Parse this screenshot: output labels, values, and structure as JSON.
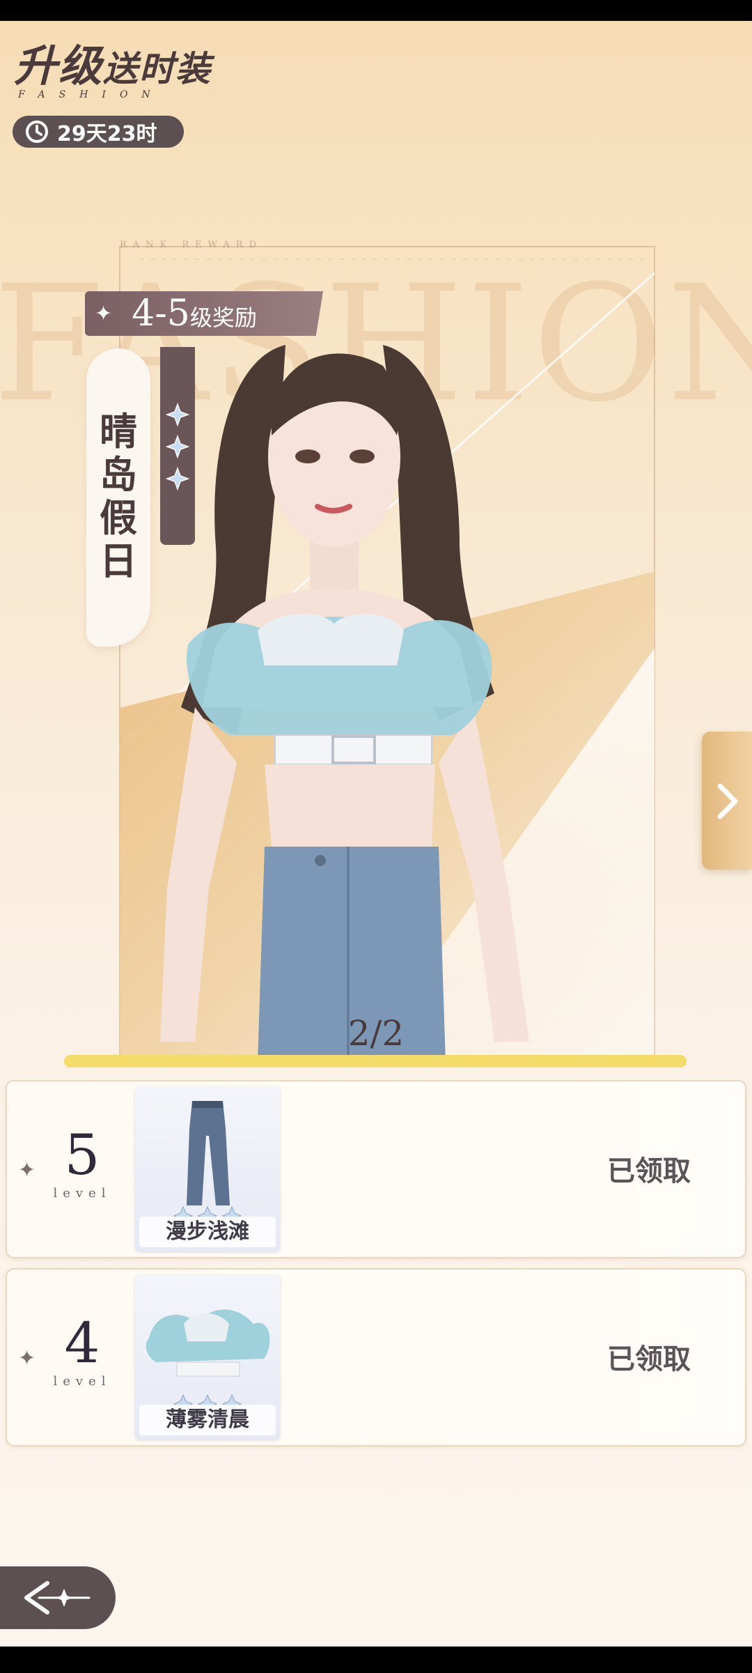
{
  "header": {
    "title_main": "升级",
    "title_rest": "送时装",
    "title_sub": "FASHION",
    "timer_text": "29天23时"
  },
  "background": {
    "big_word": "FASHION",
    "rank_reward": "RANK REWARD"
  },
  "showcase": {
    "reward_tag": "4-5",
    "reward_tag_suffix": "级奖励",
    "outfit_name": "晴岛假日",
    "star_count": 3,
    "pager": "2/2",
    "progress": 1.0
  },
  "rewards": [
    {
      "level": "5",
      "level_word": "level",
      "item_name": "漫步浅滩",
      "status": "已领取",
      "icon": "jeans-icon"
    },
    {
      "level": "4",
      "level_word": "level",
      "item_name": "薄雾清晨",
      "status": "已领取",
      "icon": "ruffle-top-icon"
    }
  ],
  "colors": {
    "accent_dark": "#5d5052",
    "tag_brown": "#7a5f63",
    "progress_yellow": "#f4dc6a",
    "gold": "#e7b877"
  },
  "icons": {
    "timer": "clock-icon",
    "next": "chevron-right-icon",
    "back": "back-arrow-icon",
    "star": "sparkle-icon"
  }
}
